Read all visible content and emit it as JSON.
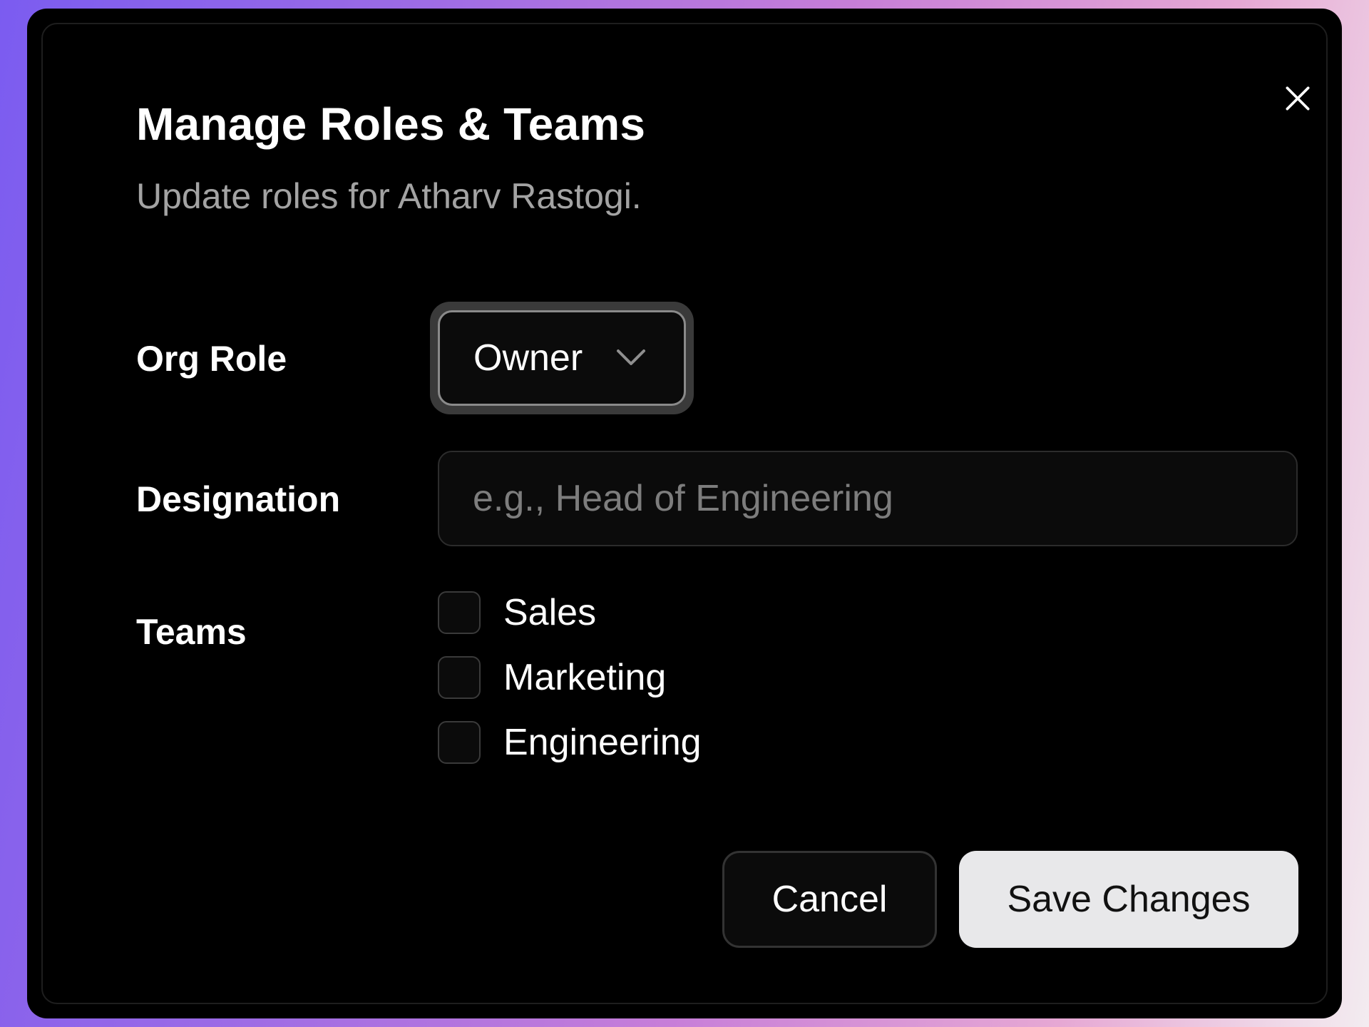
{
  "dialog": {
    "title": "Manage Roles & Teams",
    "subtitle": "Update roles for Atharv Rastogi.",
    "close_icon": "close-icon"
  },
  "form": {
    "org_role": {
      "label": "Org Role",
      "value": "Owner",
      "icon": "chevron-down-icon"
    },
    "designation": {
      "label": "Designation",
      "value": "",
      "placeholder": "e.g., Head of Engineering"
    },
    "teams": {
      "label": "Teams",
      "options": [
        {
          "label": "Sales",
          "checked": false
        },
        {
          "label": "Marketing",
          "checked": false
        },
        {
          "label": "Engineering",
          "checked": false
        }
      ]
    }
  },
  "actions": {
    "cancel_label": "Cancel",
    "save_label": "Save Changes"
  },
  "colors": {
    "dialog_background": "#000000",
    "primary_button": "#e8e8ea",
    "muted_text": "#a3a3a3"
  }
}
